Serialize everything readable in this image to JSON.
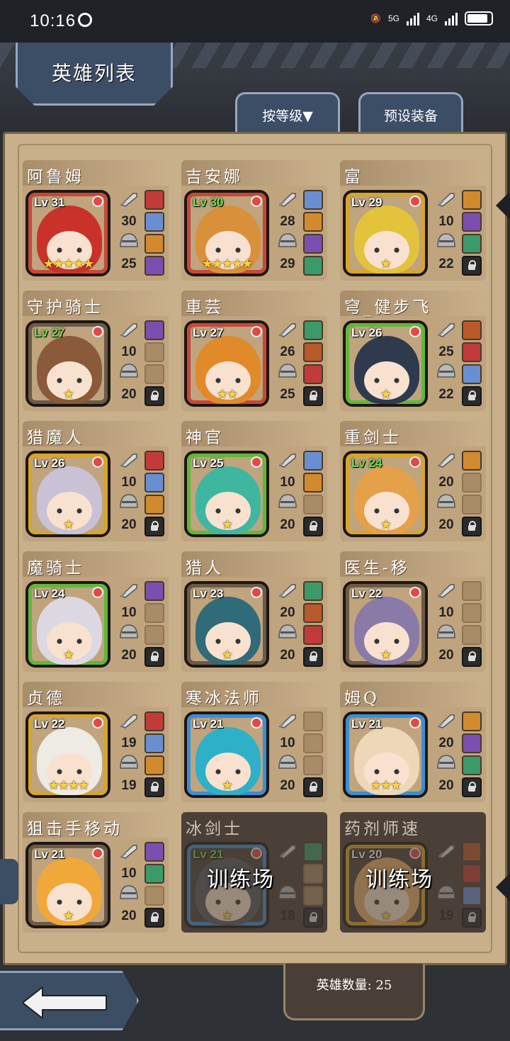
{
  "status_bar": {
    "time": "10:16",
    "network_1": "5G",
    "network_2": "4G"
  },
  "header": {
    "title": "英雄列表",
    "sort_button": "按等级▼",
    "preset_button": "预设装备"
  },
  "footer": {
    "hero_count": "英雄数量: 25"
  },
  "heroes": [
    {
      "name": "阿鲁姆",
      "level": "Lv 31",
      "atk": "30",
      "def": "25",
      "frame": "red",
      "stars": "★★★★★"
    },
    {
      "name": "吉安娜",
      "level": "Lv 30",
      "atk": "28",
      "def": "29",
      "frame": "red",
      "stars": "★★★★★"
    },
    {
      "name": "富",
      "level": "Lv 29",
      "atk": "10",
      "def": "22",
      "frame": "gold",
      "stars": "★"
    },
    {
      "name": "守护骑士",
      "level": "Lv 27",
      "atk": "10",
      "def": "20",
      "frame": "brown",
      "stars": "★"
    },
    {
      "name": "車芸",
      "level": "Lv 27",
      "atk": "26",
      "def": "25",
      "frame": "red",
      "stars": "★★"
    },
    {
      "name": "穹_健步飞",
      "level": "Lv 26",
      "atk": "25",
      "def": "22",
      "frame": "green",
      "stars": "★"
    },
    {
      "name": "猎魔人",
      "level": "Lv 26",
      "atk": "10",
      "def": "20",
      "frame": "gold",
      "stars": "★"
    },
    {
      "name": "神官",
      "level": "Lv 25",
      "atk": "10",
      "def": "20",
      "frame": "green",
      "stars": "★"
    },
    {
      "name": "重剑士",
      "level": "Lv 24",
      "atk": "20",
      "def": "20",
      "frame": "gold",
      "stars": "★"
    },
    {
      "name": "魔骑士",
      "level": "Lv 24",
      "atk": "10",
      "def": "20",
      "frame": "green",
      "stars": "★"
    },
    {
      "name": "猎人",
      "level": "Lv 23",
      "atk": "20",
      "def": "20",
      "frame": "brown",
      "stars": "★"
    },
    {
      "name": "医生-移",
      "level": "Lv 22",
      "atk": "10",
      "def": "20",
      "frame": "brown",
      "stars": "★"
    },
    {
      "name": "贞德",
      "level": "Lv 22",
      "atk": "19",
      "def": "19",
      "frame": "gold",
      "stars": "★★★★"
    },
    {
      "name": "寒冰法师",
      "level": "Lv 21",
      "atk": "10",
      "def": "20",
      "frame": "blue",
      "stars": "★"
    },
    {
      "name": "姆Q",
      "level": "Lv 21",
      "atk": "20",
      "def": "20",
      "frame": "blue",
      "stars": "★★★"
    },
    {
      "name": "狙击手移动",
      "level": "Lv 21",
      "atk": "10",
      "def": "20",
      "frame": "brown",
      "stars": "★"
    },
    {
      "name": "冰剑士",
      "level": "Lv 21",
      "atk": "",
      "def": "18",
      "frame": "blue",
      "stars": "★",
      "overlay": "训练场"
    },
    {
      "name": "药剂师速",
      "level": "Lv 20",
      "atk": "",
      "def": "19",
      "frame": "gold",
      "stars": "★",
      "overlay": "训练场"
    }
  ],
  "level_green": [
    1,
    3,
    8,
    16
  ],
  "slot_states": [
    [
      "eq",
      "eq",
      "eq",
      "eq"
    ],
    [
      "eq",
      "eq",
      "eq",
      "eq"
    ],
    [
      "eq",
      "eq",
      "eq",
      "lock"
    ],
    [
      "eq",
      "empty",
      "empty",
      "lock"
    ],
    [
      "eq",
      "eq",
      "eq",
      "lock"
    ],
    [
      "eq",
      "eq",
      "eq",
      "lock"
    ],
    [
      "eq",
      "eq",
      "eq",
      "lock"
    ],
    [
      "eq",
      "eq",
      "empty",
      "lock"
    ],
    [
      "eq",
      "empty",
      "empty",
      "lock"
    ],
    [
      "eq",
      "empty",
      "empty",
      "lock"
    ],
    [
      "eq",
      "eq",
      "eq",
      "lock"
    ],
    [
      "empty",
      "empty",
      "empty",
      "lock"
    ],
    [
      "eq",
      "eq",
      "eq",
      "lock"
    ],
    [
      "empty",
      "empty",
      "empty",
      "lock"
    ],
    [
      "eq",
      "eq",
      "eq",
      "lock"
    ],
    [
      "eq",
      "eq",
      "empty",
      "lock"
    ],
    [
      "eq",
      "empty",
      "empty",
      "lock"
    ],
    [
      "eq",
      "eq",
      "eq",
      "lock"
    ]
  ],
  "colors": {
    "hair": [
      "#c8322a",
      "#d8903a",
      "#e3c23c",
      "#8a5a3a",
      "#e08a2a",
      "#2f3a4e",
      "#c9c2d6",
      "#3fb7a0",
      "#e5a04a",
      "#dcd8e2",
      "#2f6b78",
      "#8a7aa8",
      "#eeeae4",
      "#2fb0c9",
      "#eed6b8",
      "#f0a83a",
      "#555a60",
      "#e8b06a"
    ]
  }
}
